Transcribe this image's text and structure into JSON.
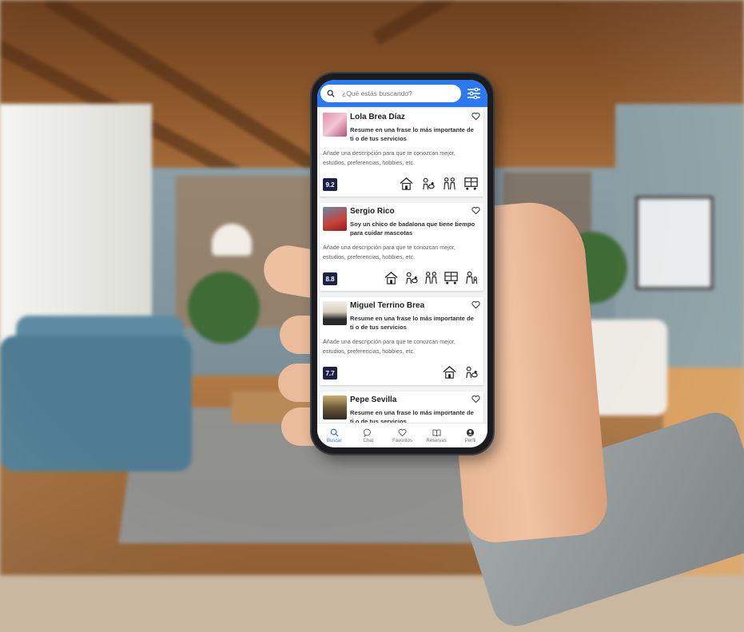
{
  "search": {
    "placeholder": "¿Qué estás buscando?"
  },
  "colors": {
    "accent": "#2b78f2",
    "score_bg": "#1e2147"
  },
  "cards": [
    {
      "name": "Lola Brea Díaz",
      "summary": "Resume en una frase lo más importante de ti o de tus servicios",
      "description": "Añade una descripción para que te conozcan mejor, estudios, preferencias, hobbies, etc.",
      "score": "9.2",
      "service_icons": [
        "house-care-icon",
        "pet-care-icon",
        "elderly-care-icon",
        "moving-icon"
      ]
    },
    {
      "name": "Sergio Rico",
      "summary": "Soy un chico de badalona que tiene tiempo para cuidar mascotas",
      "description": "Añade una descripción para que te conozcan mejor, estudios, preferencias, hobbies, etc.",
      "score": "8.8",
      "service_icons": [
        "house-care-icon",
        "pet-care-icon",
        "elderly-care-icon",
        "moving-icon",
        "childcare-icon"
      ]
    },
    {
      "name": "Miguel Terrino Brea",
      "summary": "Resume en una frase lo más importante de ti o de tus servicios",
      "description": "Añade una descripción para que te conozcan mejor, estudios, preferencias, hobbies, etc.",
      "score": "7.7",
      "service_icons": [
        "house-care-icon",
        "pet-care-icon"
      ]
    },
    {
      "name": "Pepe Sevilla",
      "summary": "Resume en una frase lo más importante de ti o de tus servicios",
      "description": "",
      "score": "",
      "service_icons": []
    }
  ],
  "nav": [
    {
      "label": "Buscar",
      "icon": "search-icon",
      "active": true
    },
    {
      "label": "Chat",
      "icon": "chat-icon",
      "active": false
    },
    {
      "label": "Favoritos",
      "icon": "heart-icon",
      "active": false
    },
    {
      "label": "Reservas",
      "icon": "book-icon",
      "active": false
    },
    {
      "label": "Perfil",
      "icon": "profile-icon",
      "active": false
    }
  ]
}
